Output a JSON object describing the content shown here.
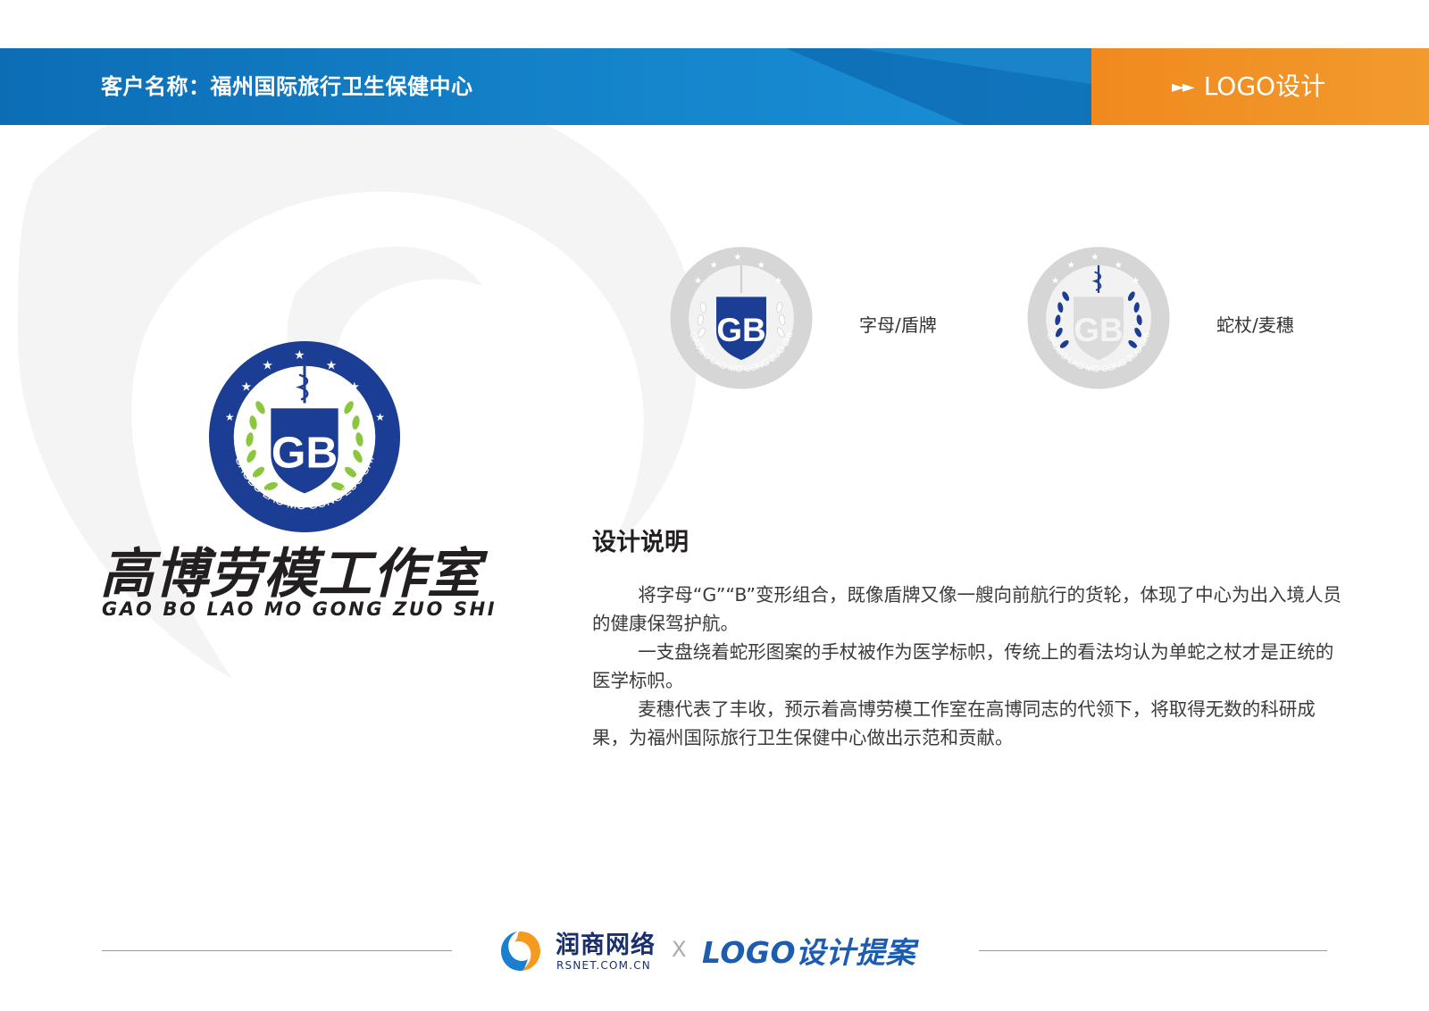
{
  "header": {
    "client_label": "客户名称：福州国际旅行卫生保健中心",
    "tag_arrows": "►►",
    "tag_label": "LOGO设计"
  },
  "emblem": {
    "initials": "GB",
    "ring_text": "GAOBO LAO MO GONG ZUO SHI",
    "colors": {
      "blue": "#1b3e94",
      "green": "#8cc63f",
      "grey": "#c8c8c8"
    }
  },
  "brand": {
    "name_cn": "高博劳模工作室",
    "name_en": "GAO BO LAO MO GONG ZUO SHI"
  },
  "variants": [
    {
      "label": "字母/盾牌"
    },
    {
      "label": "蛇杖/麦穗"
    }
  ],
  "description": {
    "title": "设计说明",
    "paragraphs": [
      "将字母“G”“B”变形组合，既像盾牌又像一艘向前航行的货轮，体现了中心为出入境人员的健康保驾护航。",
      "一支盘绕着蛇形图案的手杖被作为医学标帜，传统上的看法均认为单蛇之杖才是正统的医学标帜。",
      "麦穗代表了丰收，预示着高博劳模工作室在高博同志的代领下，将取得无数的科研成果，为福州国际旅行卫生保健中心做出示范和贡献。"
    ]
  },
  "footer": {
    "company": "润商网络",
    "domain": "RSNET.COM.CN",
    "separator": "X",
    "proposal": "LOGO设计提案"
  }
}
